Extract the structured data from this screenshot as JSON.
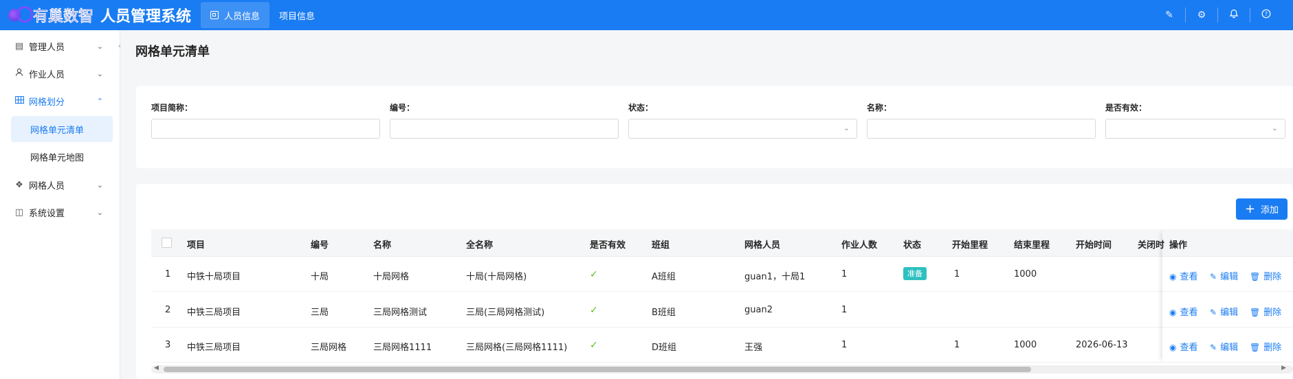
{
  "app": {
    "brand": "有巢数智",
    "title": "人员管理系统"
  },
  "top_tabs": [
    {
      "label": "人员信息"
    },
    {
      "label": "项目信息"
    }
  ],
  "header_icons": [
    "pen-icon",
    "gear-icon",
    "bell-icon",
    "help-icon"
  ],
  "sidebar": {
    "items": [
      {
        "label": "管理人员",
        "icon": "profile-icon"
      },
      {
        "label": "作业人员",
        "icon": "user-icon"
      },
      {
        "label": "网格划分",
        "icon": "grid-icon"
      },
      {
        "label": "网格人员",
        "icon": "cube-icon"
      },
      {
        "label": "系统设置",
        "icon": "settings-box-icon"
      }
    ],
    "sub_items": [
      {
        "label": "网格单元清单"
      },
      {
        "label": "网格单元地图"
      }
    ]
  },
  "page": {
    "title": "网格单元清单"
  },
  "filters": [
    {
      "label": "项目简称：",
      "value": ""
    },
    {
      "label": "编号：",
      "value": ""
    },
    {
      "label": "状态：",
      "value": ""
    },
    {
      "label": "名称：",
      "value": ""
    },
    {
      "label": "是否有效：",
      "value": ""
    }
  ],
  "actions": {
    "add": "添加"
  },
  "table": {
    "columns": [
      "项目",
      "编号",
      "名称",
      "全名称",
      "是否有效",
      "班组",
      "网格人员",
      "作业人数",
      "状态",
      "开始里程",
      "结束里程",
      "开始时间",
      "关闭时",
      "操作"
    ],
    "rows": [
      {
        "index": "1",
        "project": "中铁十局项目",
        "code": "十局",
        "name": "十局网格",
        "full_name": "十局(十局网格)",
        "valid": "✓",
        "team": "A班组",
        "grid_staff": "guan1，十局1",
        "workers": "1",
        "status": "准备",
        "start_mileage": "1",
        "end_mileage": "1000",
        "start_time": ""
      },
      {
        "index": "2",
        "project": "中铁三局项目",
        "code": "三局",
        "name": "三局网格测试",
        "full_name": "三局(三局网格测试)",
        "valid": "✓",
        "team": "B班组",
        "grid_staff": "guan2",
        "workers": "1",
        "status": "",
        "start_mileage": "",
        "end_mileage": "",
        "start_time": ""
      },
      {
        "index": "3",
        "project": "中铁三局项目",
        "code": "三局网格",
        "name": "三局网格1111",
        "full_name": "三局网格(三局网格1111)",
        "valid": "✓",
        "team": "D班组",
        "grid_staff": "王强",
        "workers": "1",
        "status": "",
        "start_mileage": "1",
        "end_mileage": "1000",
        "start_time": "2026-06-13"
      }
    ],
    "row_actions": {
      "view": "查看",
      "edit": "编辑",
      "delete": "删除"
    }
  },
  "colors": {
    "primary": "#1a7cf2",
    "status_ready": "#2ec0c0",
    "valid_check": "#52c41a"
  }
}
